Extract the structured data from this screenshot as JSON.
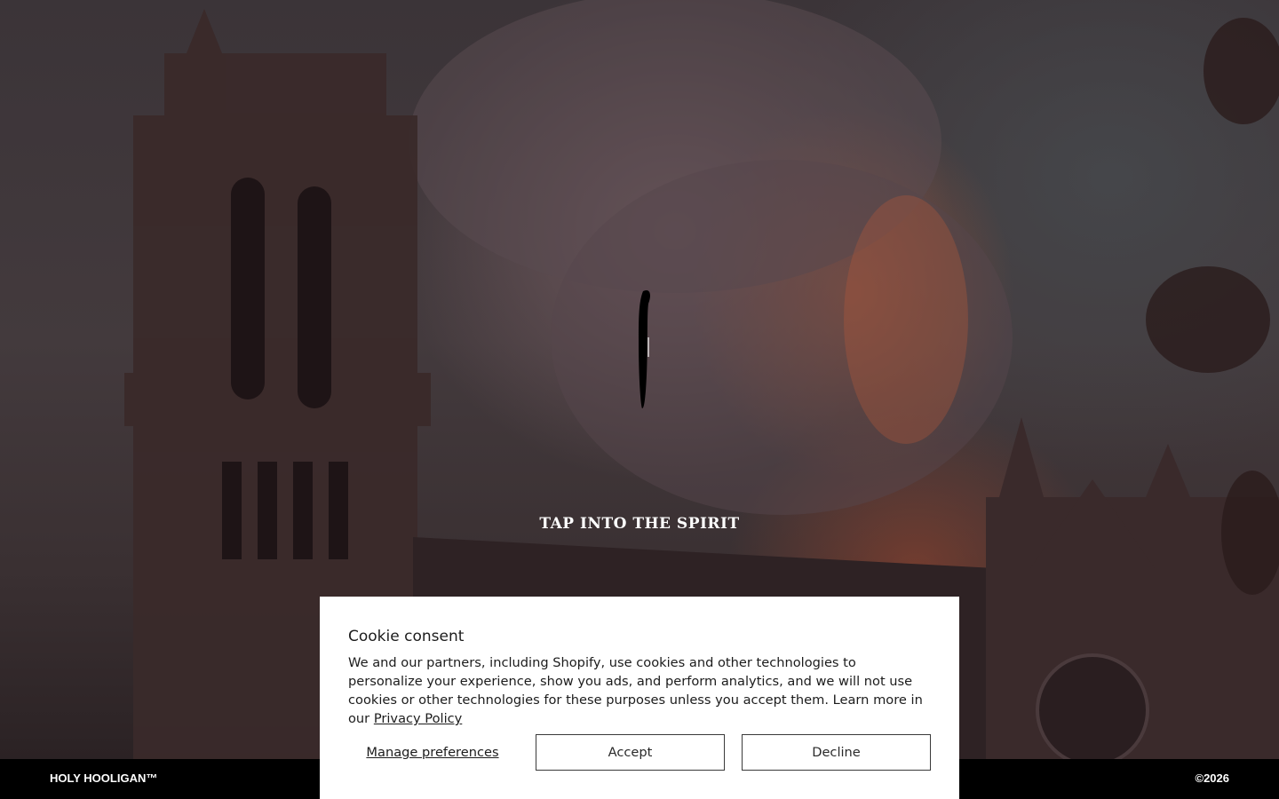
{
  "hero": {
    "tagline": "TAP INTO THE SPIRIT"
  },
  "footer": {
    "brand": "HOLY HOOLIGAN™",
    "copyright": "©2026"
  },
  "consent": {
    "title": "Cookie consent",
    "body": "We and our partners, including Shopify, use cookies and other technologies to personalize your experience, show you ads, and perform analytics, and we will not use cookies or other technologies for these purposes unless you accept them. Learn more in our ",
    "privacy_link": "Privacy Policy",
    "manage_label": "Manage preferences",
    "accept_label": "Accept",
    "decline_label": "Decline"
  },
  "icons": {
    "center_mark": "candle-flame-logo-icon"
  }
}
